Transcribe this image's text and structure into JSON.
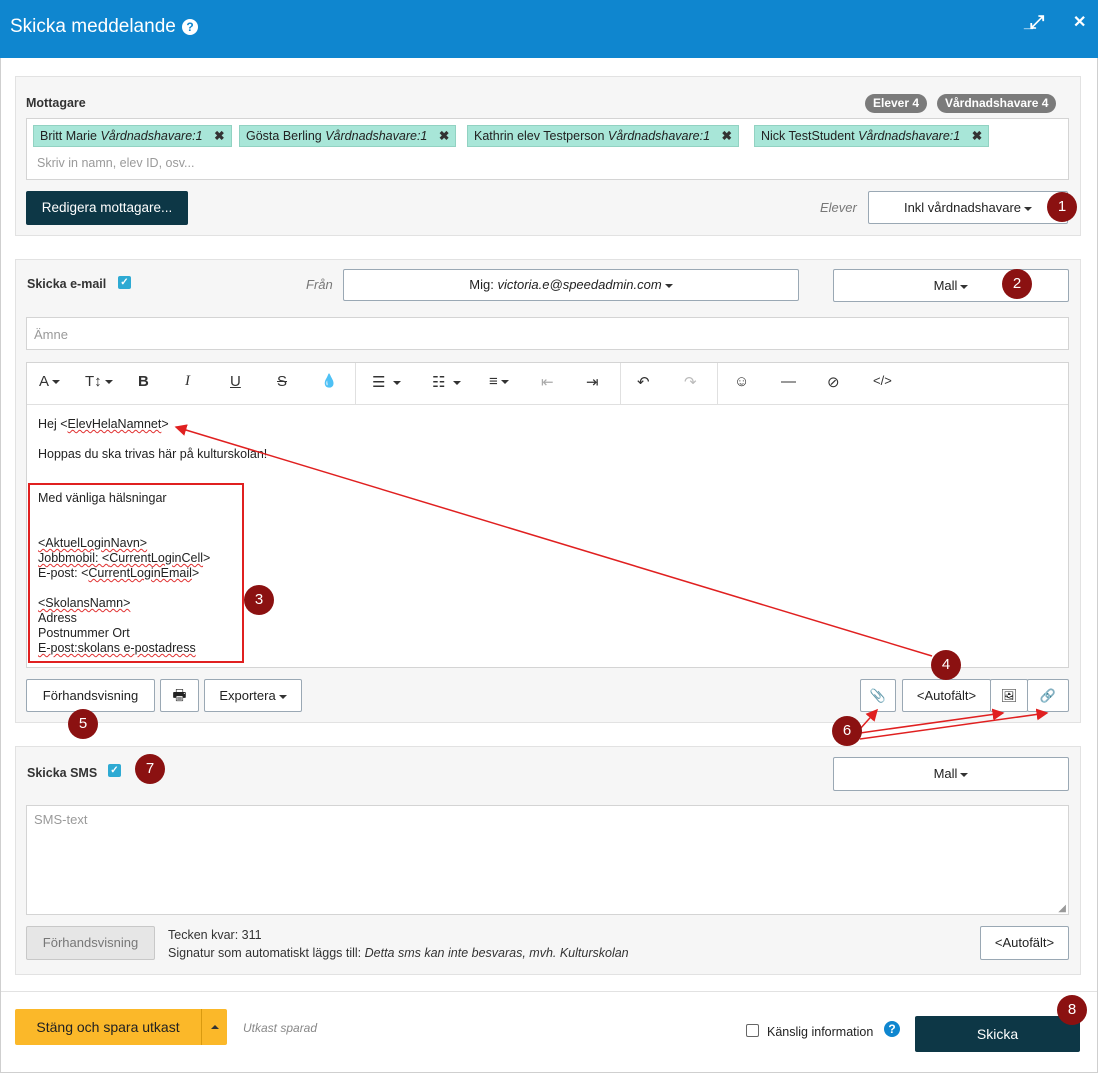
{
  "window": {
    "title": "Skicka meddelande",
    "help": "?",
    "minimize": "_",
    "maximize": "⤢",
    "close": "✕"
  },
  "recipients": {
    "label": "Mottagare",
    "badges": [
      "Elever 4",
      "Vårdnadshavare 4"
    ],
    "tags": [
      {
        "name": "Britt Marie",
        "role": "Vårdnadshavare:1"
      },
      {
        "name": "Gösta Berling",
        "role": "Vårdnadshavare:1"
      },
      {
        "name": "Kathrin elev Testperson",
        "role": "Vårdnadshavare:1"
      },
      {
        "name": "Nick TestStudent",
        "role": "Vårdnadshavare:1"
      }
    ],
    "remove_icon": "✖",
    "placeholder": "Skriv in namn, elev ID, osv...",
    "edit_button": "Redigera mottagare...",
    "filter_label": "Elever",
    "filter_value": "Inkl vårdnadshavare"
  },
  "email": {
    "label": "Skicka e-mail",
    "checked": true,
    "from_label": "Från",
    "from_prefix": "Mig:",
    "from_value": "victoria.e@speedadmin.com",
    "template_button": "Mall",
    "subject_placeholder": "Ämne",
    "toolbar": [
      "A",
      "T↕",
      "B",
      "I",
      "U",
      "S",
      "💧",
      "☰",
      "☷",
      "≡",
      "⇤",
      "⇥",
      "↶",
      "↷",
      "☺",
      "—",
      "⊘",
      "</>"
    ],
    "body": {
      "greeting_prefix": "Hej <",
      "greeting_token": "ElevHelaNamnet",
      "greeting_suffix": ">",
      "line2": "Hoppas du ska trivas här på kulturskolan!",
      "signature": {
        "closing": "Med vänliga hälsningar",
        "login_name": "<AktuelLoginNavn>",
        "mobile_prefix": "Jobbmobil: <",
        "mobile_token": "CurrentLoginCell",
        "mobile_suffix": ">",
        "email_prefix": "E-post: <",
        "email_token": "CurrentLoginEmail",
        "email_suffix": ">",
        "school": "<SkolansNamn>",
        "address": "Adress",
        "postal": "Postnummer Ort",
        "school_email": "E-post:skolans e-postadress"
      }
    },
    "preview_button": "Förhandsvisning",
    "print_icon": "🖶",
    "export_button": "Exportera",
    "attach_icon": "📎",
    "autofield_button": "<Autofält>",
    "image_icon": "🖼",
    "link_icon": "🔗"
  },
  "sms": {
    "label": "Skicka SMS",
    "checked": true,
    "template_button": "Mall",
    "text_placeholder": "SMS-text",
    "preview_button": "Förhandsvisning",
    "chars_left": "Tecken kvar: 311",
    "signature_prefix": "Signatur som automatiskt läggs till:",
    "signature_text": "Detta sms kan inte besvaras, mvh. Kulturskolan",
    "autofield_button": "<Autofält>"
  },
  "footer": {
    "save_button": "Stäng och spara utkast",
    "draft_status": "Utkast sparad",
    "sensitive_label": "Känslig information",
    "help": "?",
    "send_button": "Skicka"
  },
  "annotations": [
    "1",
    "2",
    "3",
    "4",
    "5",
    "6",
    "7",
    "8"
  ],
  "colors": {
    "titlebar": "#0f86cf",
    "dark_button": "#0d3746",
    "warning_button": "#fbb829",
    "tag": "#a8e6d8",
    "annotation": "#8b1111",
    "arrow": "#e02020"
  }
}
